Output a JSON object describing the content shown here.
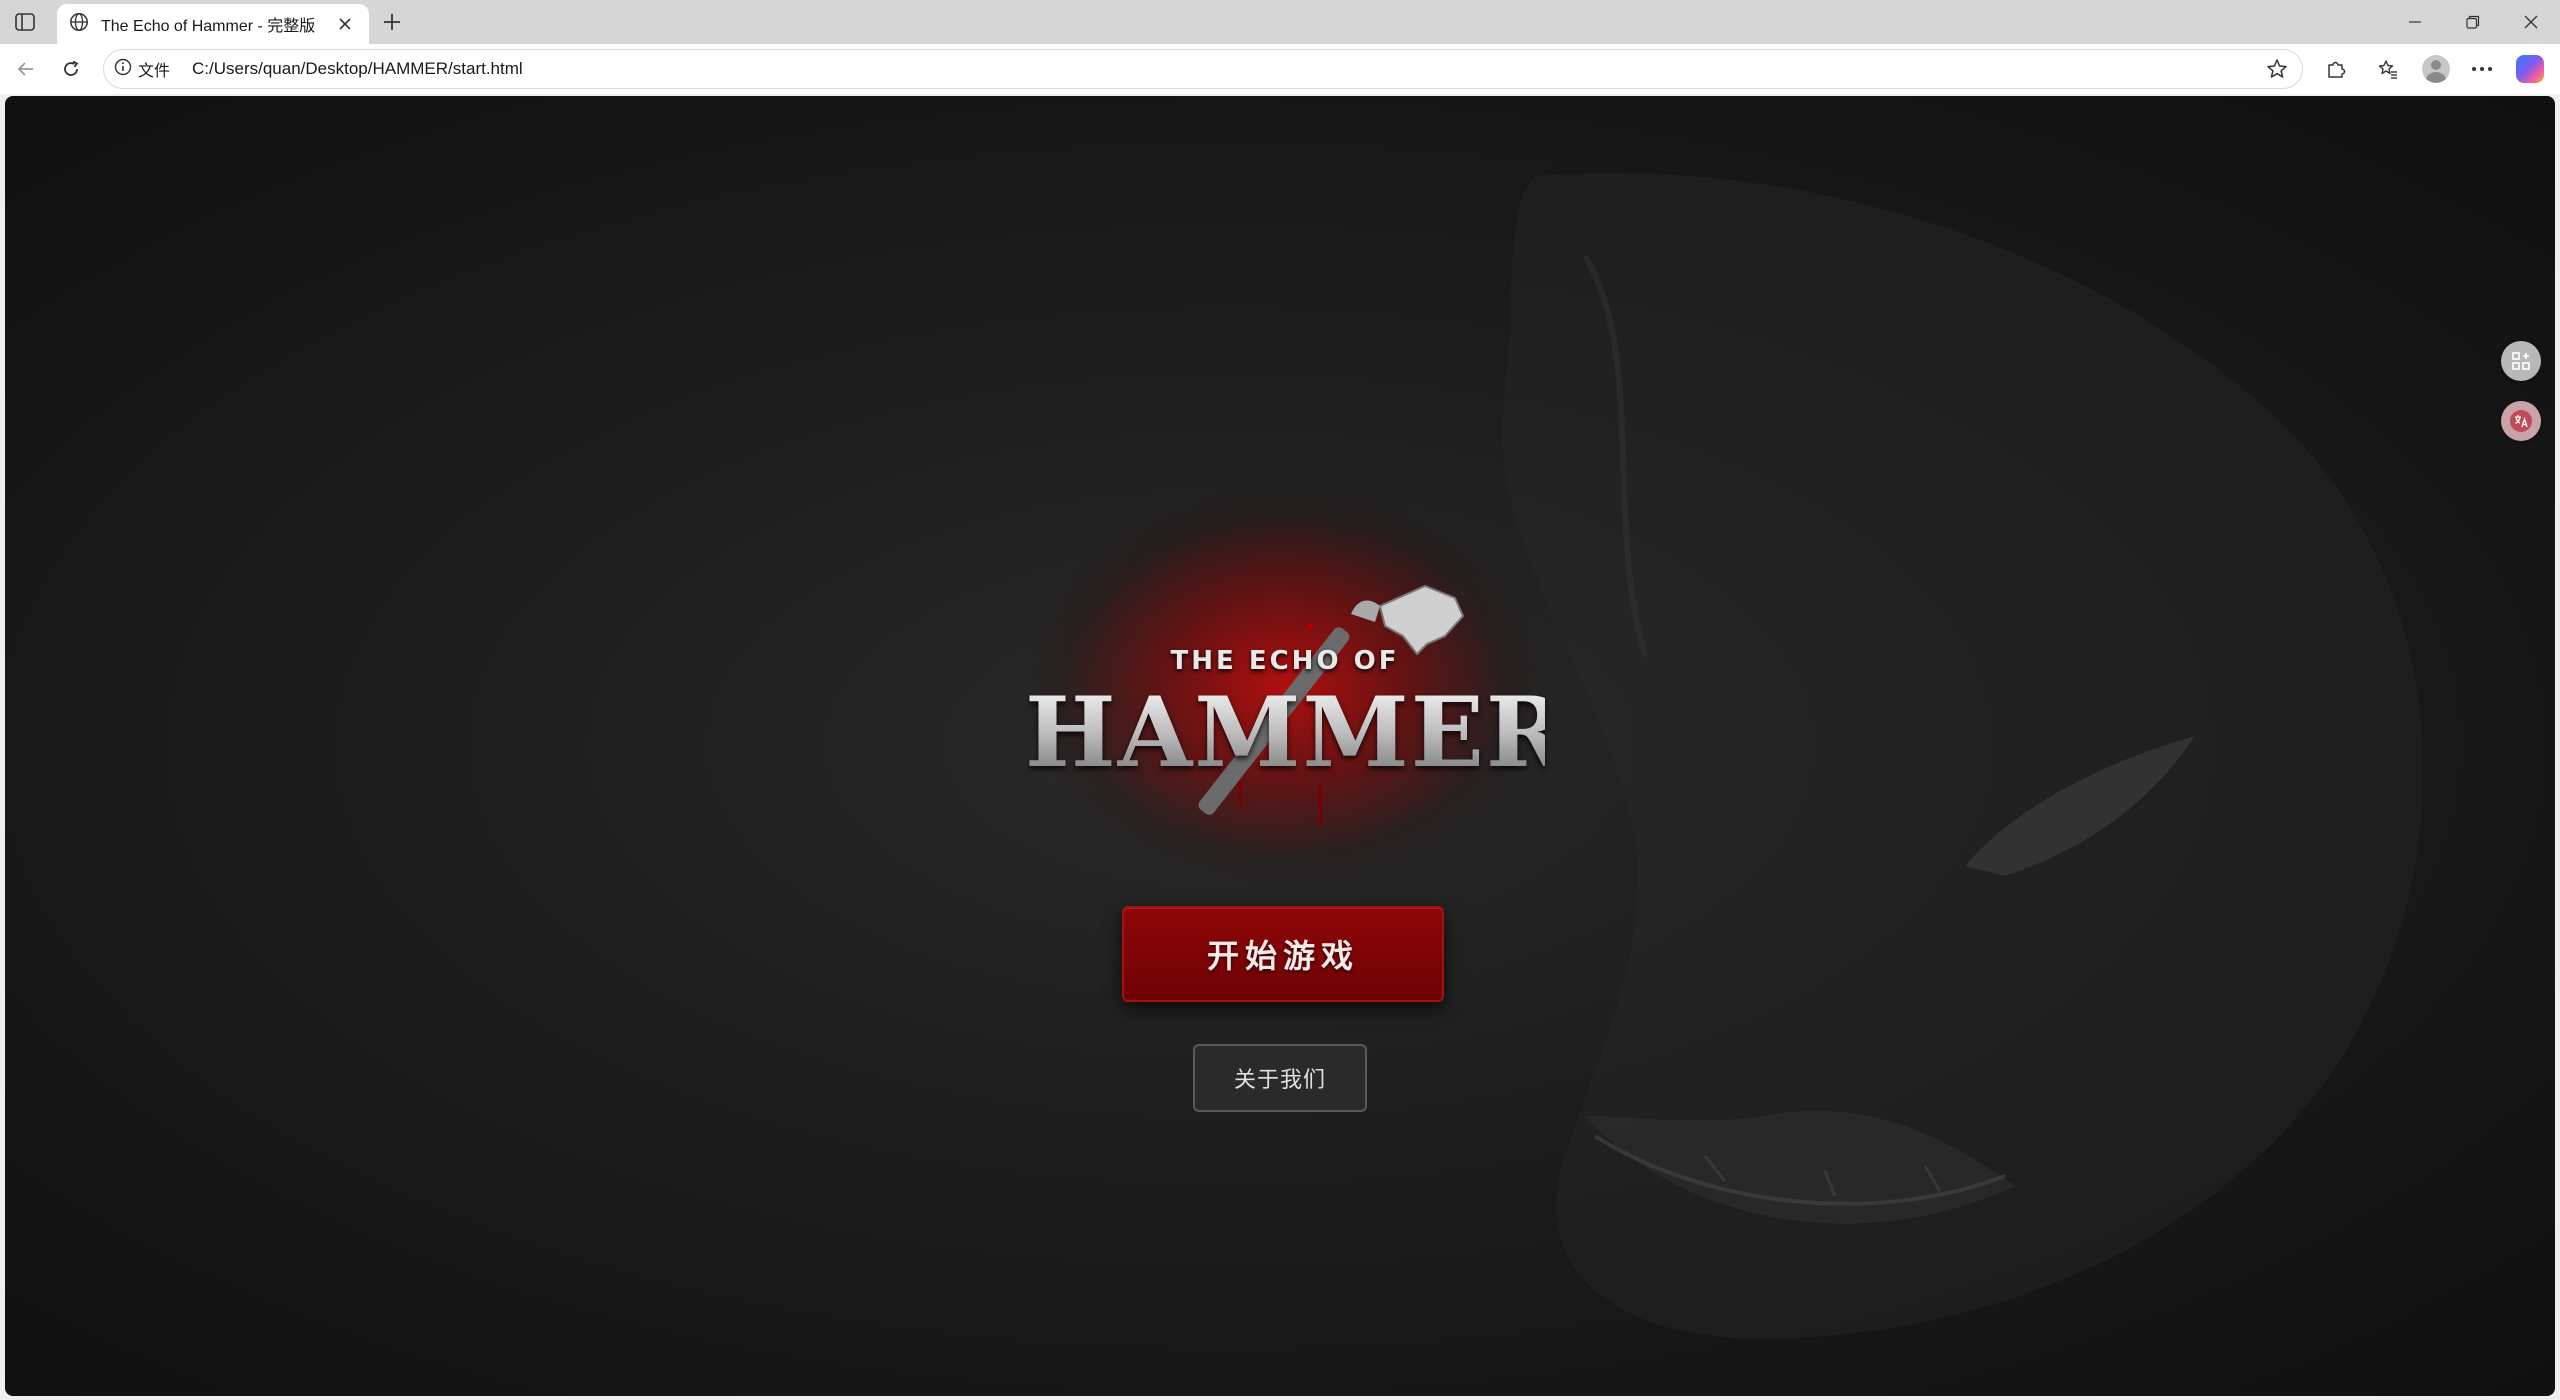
{
  "browser": {
    "tab": {
      "title": "The Echo of Hammer - 完整版",
      "icon": "globe-icon"
    },
    "address": {
      "site_label": "文件",
      "url": "C:/Users/quan/Desktop/HAMMER/start.html"
    }
  },
  "page": {
    "logo": {
      "subtitle": "THE ECHO OF",
      "title": "HAMMER"
    },
    "start_button": "开始游戏",
    "about_button": "关于我们",
    "accent_color": "#8f0608"
  }
}
